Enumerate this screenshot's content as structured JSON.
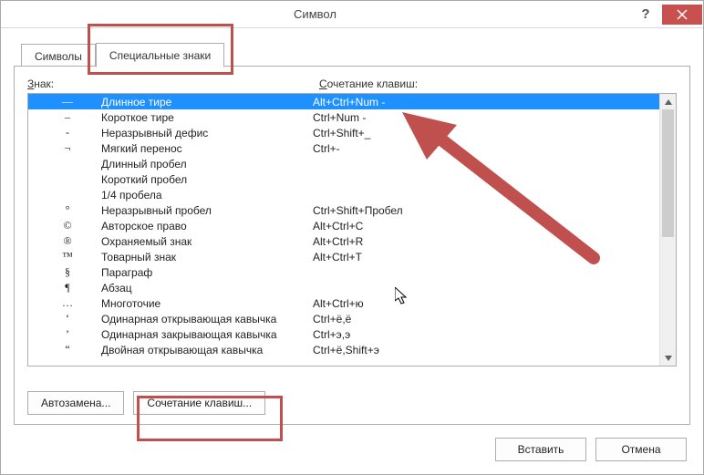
{
  "title": "Символ",
  "tabs": {
    "symbols": "Символы",
    "special": "Специальные знаки"
  },
  "headers": {
    "char": "Знак:",
    "char_u": "З",
    "shortcut": "Сочетание клавиш:",
    "shortcut_u": "С"
  },
  "rows": [
    {
      "sym": "—",
      "label": "Длинное тире",
      "key": "Alt+Ctrl+Num -"
    },
    {
      "sym": "–",
      "label": "Короткое тире",
      "key": "Ctrl+Num -"
    },
    {
      "sym": "-",
      "label": "Неразрывный дефис",
      "key": "Ctrl+Shift+_"
    },
    {
      "sym": "¬",
      "label": "Мягкий перенос",
      "key": "Ctrl+-"
    },
    {
      "sym": "",
      "label": "Длинный пробел",
      "key": ""
    },
    {
      "sym": "",
      "label": "Короткий пробел",
      "key": ""
    },
    {
      "sym": "",
      "label": "1/4 пробела",
      "key": ""
    },
    {
      "sym": "°",
      "label": "Неразрывный пробел",
      "key": "Ctrl+Shift+Пробел"
    },
    {
      "sym": "©",
      "label": "Авторское право",
      "key": "Alt+Ctrl+C"
    },
    {
      "sym": "®",
      "label": "Охраняемый знак",
      "key": "Alt+Ctrl+R"
    },
    {
      "sym": "™",
      "label": "Товарный знак",
      "key": "Alt+Ctrl+T"
    },
    {
      "sym": "§",
      "label": "Параграф",
      "key": ""
    },
    {
      "sym": "¶",
      "label": "Абзац",
      "key": ""
    },
    {
      "sym": "…",
      "label": "Многоточие",
      "key": "Alt+Ctrl+ю"
    },
    {
      "sym": "‘",
      "label": "Одинарная открывающая кавычка",
      "key": "Ctrl+ё,ё"
    },
    {
      "sym": "’",
      "label": "Одинарная закрывающая кавычка",
      "key": "Ctrl+э,э"
    },
    {
      "sym": "“",
      "label": "Двойная открывающая кавычка",
      "key": "Ctrl+ё,Shift+э"
    }
  ],
  "buttons": {
    "autocorrect": "Автозамена...",
    "shortcut": "Сочетание клавиш...",
    "insert": "Вставить",
    "cancel": "Отмена"
  }
}
